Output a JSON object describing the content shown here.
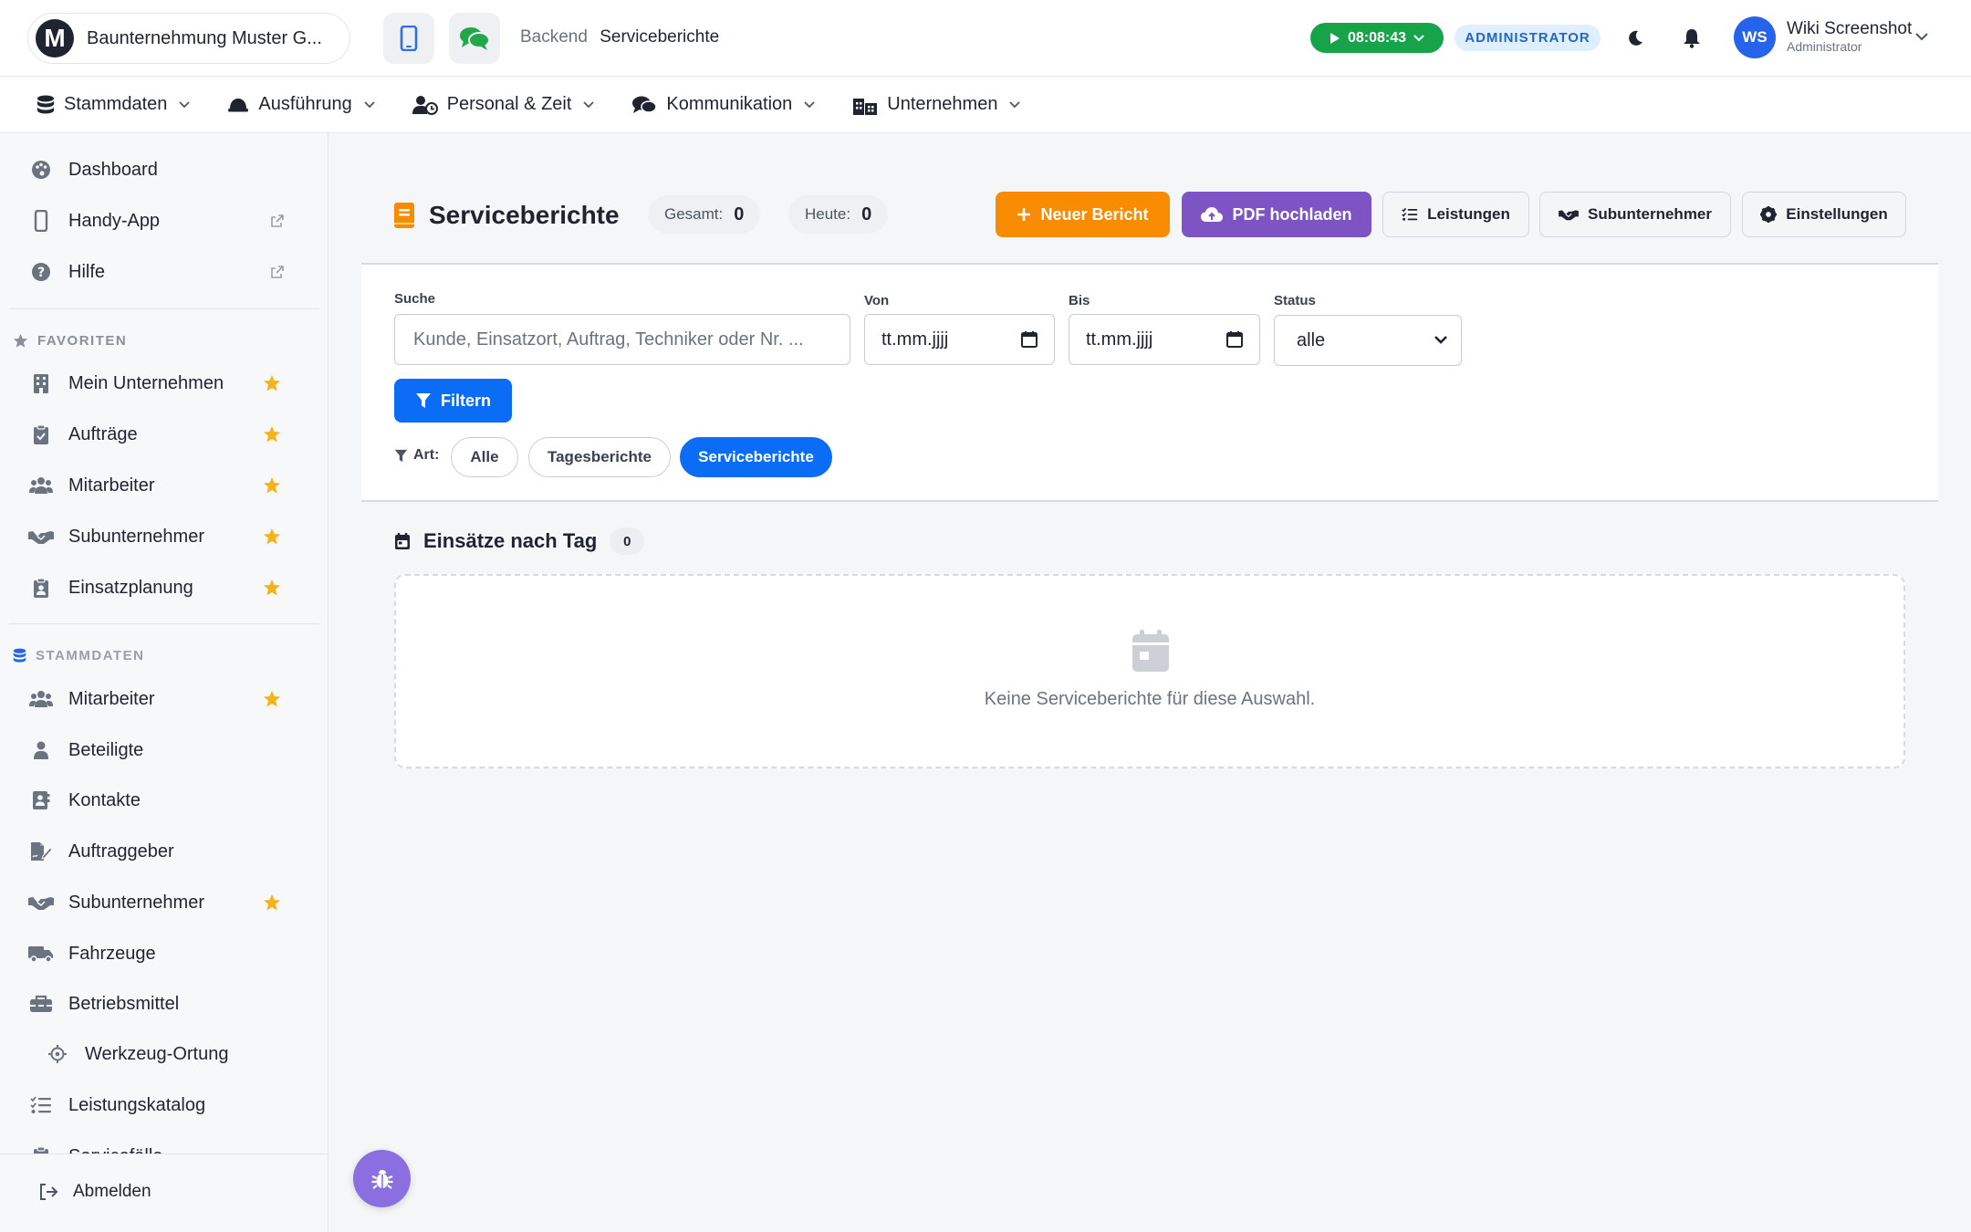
{
  "header": {
    "brand_logo": "M",
    "company": "Baunternehmung Muster G...",
    "breadcrumb": [
      "Backend",
      "Serviceberichte"
    ],
    "timer": "08:08:43",
    "role_badge": "ADMINISTRATOR",
    "user": {
      "initials": "WS",
      "name": "Wiki Screenshot",
      "role": "Administrator"
    },
    "icons": [
      "mobile-phone-icon",
      "chat-bubbles-icon",
      "play-icon",
      "moon-icon",
      "bell-icon",
      "chevron-down-icon"
    ]
  },
  "main_nav": [
    {
      "label": "Stammdaten",
      "icon": "database-icon"
    },
    {
      "label": "Ausführung",
      "icon": "hard-hat-icon"
    },
    {
      "label": "Personal & Zeit",
      "icon": "user-clock-icon"
    },
    {
      "label": "Kommunikation",
      "icon": "comments-icon"
    },
    {
      "label": "Unternehmen",
      "icon": "city-icon"
    }
  ],
  "sidebar": {
    "top_items": [
      {
        "label": "Dashboard",
        "icon": "palette-icon"
      },
      {
        "label": "Handy-App",
        "icon": "mobile-icon",
        "external": true
      },
      {
        "label": "Hilfe",
        "icon": "question-circle-icon",
        "external": true
      }
    ],
    "favorites_heading": "FAVORITEN",
    "favorites": [
      {
        "label": "Mein Unternehmen",
        "icon": "building-icon"
      },
      {
        "label": "Aufträge",
        "icon": "clipboard-check-icon"
      },
      {
        "label": "Mitarbeiter",
        "icon": "users-icon"
      },
      {
        "label": "Subunternehmer",
        "icon": "handshake-icon"
      },
      {
        "label": "Einsatzplanung",
        "icon": "clipboard-user-icon"
      }
    ],
    "stammdaten_heading": "STAMMDATEN",
    "stammdaten": [
      {
        "label": "Mitarbeiter",
        "icon": "users-icon",
        "starred": true
      },
      {
        "label": "Beteiligte",
        "icon": "user-icon",
        "starred": false
      },
      {
        "label": "Kontakte",
        "icon": "address-book-icon",
        "starred": false
      },
      {
        "label": "Auftraggeber",
        "icon": "file-signature-icon",
        "starred": false
      },
      {
        "label": "Subunternehmer",
        "icon": "handshake-icon",
        "starred": true
      },
      {
        "label": "Fahrzeuge",
        "icon": "truck-icon",
        "starred": false
      },
      {
        "label": "Betriebsmittel",
        "icon": "toolbox-icon",
        "starred": false
      },
      {
        "label": "Werkzeug-Ortung",
        "icon": "crosshairs-icon",
        "starred": false,
        "sub": true
      },
      {
        "label": "Leistungskatalog",
        "icon": "list-check-icon",
        "starred": false
      },
      {
        "label": "Servicefälle",
        "icon": "clipboard-icon",
        "starred": false
      }
    ],
    "logout": "Abmelden"
  },
  "page": {
    "title": "Serviceberichte",
    "stats": [
      {
        "label": "Gesamt:",
        "value": "0"
      },
      {
        "label": "Heute:",
        "value": "0"
      }
    ],
    "actions": {
      "new_report": "Neuer Bericht",
      "upload_pdf": "PDF hochladen",
      "services": "Leistungen",
      "subcontractors": "Subunternehmer",
      "settings": "Einstellungen"
    },
    "filters": {
      "search_label": "Suche",
      "search_placeholder": "Kunde, Einsatzort, Auftrag, Techniker oder Nr. ...",
      "from_label": "Von",
      "from_value": "tt.mm.jjjj",
      "to_label": "Bis",
      "to_value": "tt.mm.jjjj",
      "status_label": "Status",
      "status_value": "alle",
      "filter_button": "Filtern",
      "art_label": "Art:",
      "art_chips": [
        "Alle",
        "Tagesberichte",
        "Serviceberichte"
      ],
      "art_active": "Serviceberichte"
    },
    "section": {
      "title": "Einsätze nach Tag",
      "count": "0",
      "empty_text": "Keine Serviceberichte für diese Auswahl."
    }
  },
  "colors": {
    "orange": "#f98b00",
    "purple": "#7e53c4",
    "primary_blue": "#0b6df5",
    "timer_green": "#16a34a",
    "star_yellow": "#f6b21b"
  }
}
